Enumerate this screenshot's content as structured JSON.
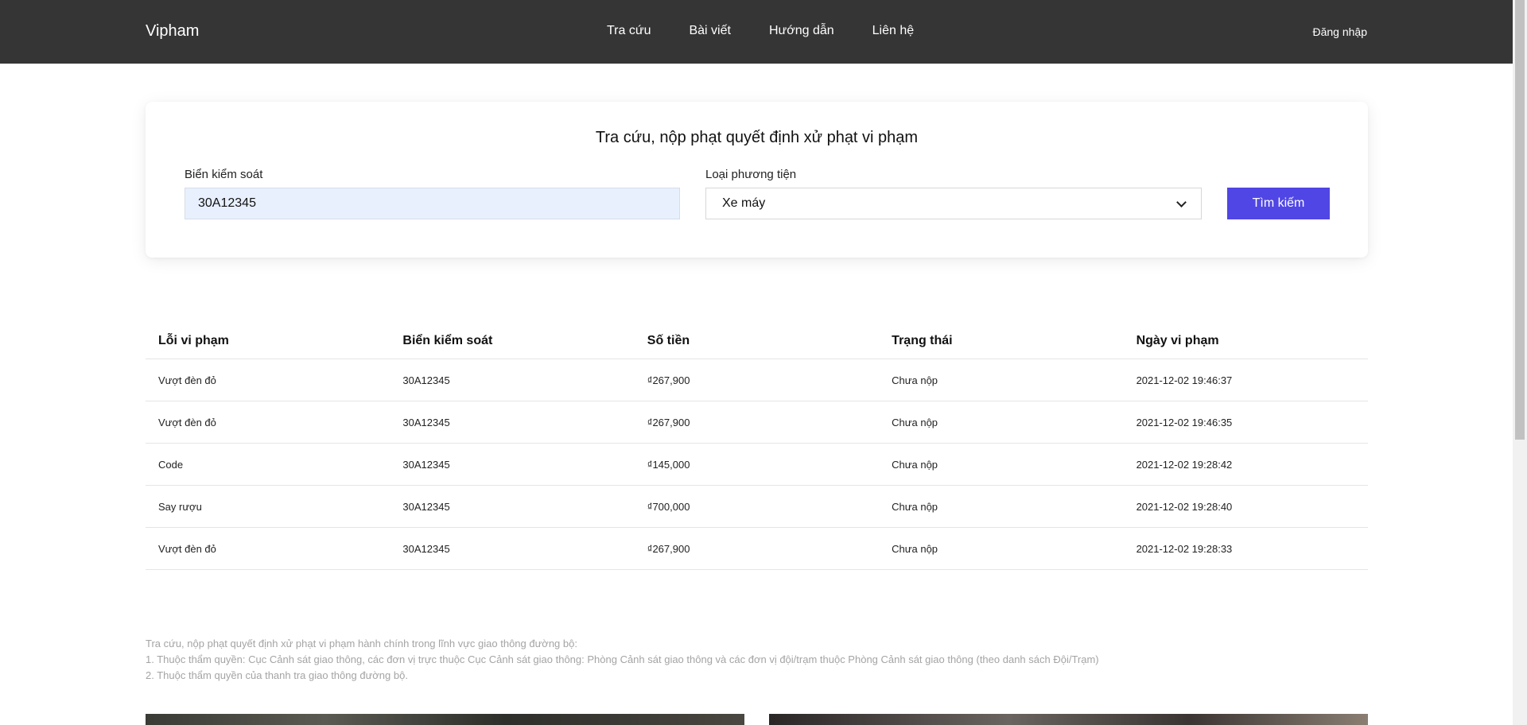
{
  "header": {
    "brand": "Vipham",
    "nav": [
      "Tra cứu",
      "Bài viết",
      "Hướng dẫn",
      "Liên hệ"
    ],
    "login": "Đăng nhập"
  },
  "search": {
    "title": "Tra cứu, nộp phạt quyết định xử phạt vi phạm",
    "plate_label": "Biển kiểm soát",
    "plate_value": "30A12345",
    "vehicle_label": "Loại phương tiện",
    "vehicle_value": "Xe máy",
    "button": "Tìm kiếm"
  },
  "table": {
    "headers": [
      "Lỗi vi phạm",
      "Biển kiểm soát",
      "Số tiền",
      "Trạng thái",
      "Ngày vi phạm"
    ],
    "rows": [
      [
        "Vượt đèn đỏ",
        "30A12345",
        "₫267,900",
        "Chưa nộp",
        "2021-12-02 19:46:37"
      ],
      [
        "Vượt đèn đỏ",
        "30A12345",
        "₫267,900",
        "Chưa nộp",
        "2021-12-02 19:46:35"
      ],
      [
        "Code",
        "30A12345",
        "₫145,000",
        "Chưa nộp",
        "2021-12-02 19:28:42"
      ],
      [
        "Say rượu",
        "30A12345",
        "₫700,000",
        "Chưa nộp",
        "2021-12-02 19:28:40"
      ],
      [
        "Vượt đèn đỏ",
        "30A12345",
        "₫267,900",
        "Chưa nộp",
        "2021-12-02 19:28:33"
      ]
    ]
  },
  "notes": [
    "Tra cứu, nộp phạt quyết định xử phạt vi phạm hành chính trong lĩnh vực giao thông đường bộ:",
    "1. Thuộc thẩm quyền: Cục Cảnh sát giao thông, các đơn vị trực thuộc Cục Cảnh sát giao thông: Phòng Cảnh sát giao thông và các đơn vị đội/trạm thuộc Phòng Cảnh sát giao thông (theo danh sách Đội/Trạm)",
    "2. Thuộc thẩm quyền của thanh tra giao thông đường bộ."
  ],
  "colors": {
    "header_bg": "#353535",
    "accent": "#5046e5",
    "input_fill": "#e8f0fe"
  }
}
